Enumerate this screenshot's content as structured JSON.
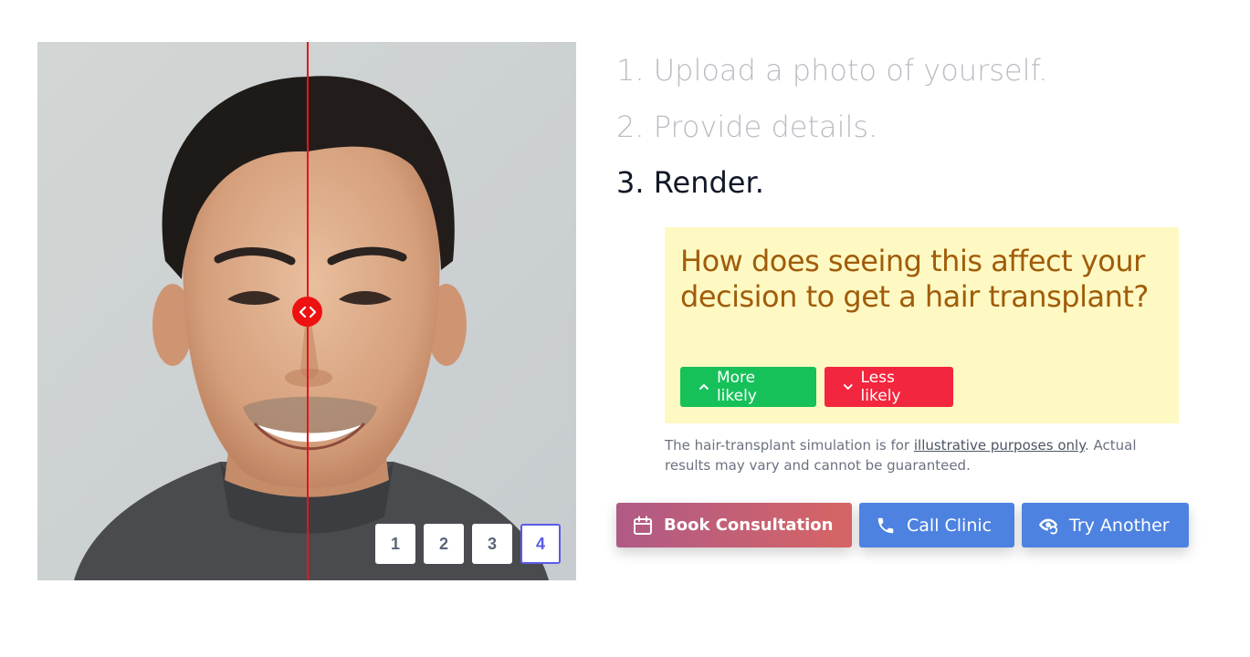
{
  "comparison": {
    "handle_icon": "code-arrows-icon",
    "thumbnails": [
      "1",
      "2",
      "3",
      "4"
    ],
    "active_thumbnail": "4"
  },
  "steps": [
    {
      "label": "1. Upload a photo of yourself."
    },
    {
      "label": "2. Provide details."
    },
    {
      "label": "3. Render."
    }
  ],
  "question": {
    "text": "How does seeing this affect your decision to get a hair transplant?",
    "more_label": "More likely",
    "more_icon": "chevron-up-icon",
    "less_label": "Less likely",
    "less_icon": "chevron-down-icon"
  },
  "disclaimer": {
    "before": "The hair-transplant simulation is for ",
    "link": "illustrative purposes only",
    "after": ". Actual results may vary and cannot be guaranteed."
  },
  "actions": {
    "book_label": "Book Consultation",
    "book_icon": "calendar-icon",
    "call_label": "Call Clinic",
    "call_icon": "phone-icon",
    "try_label": "Try Another",
    "try_icon": "eye-refresh-icon"
  },
  "colors": {
    "divider": "#e8141b",
    "question_bg": "#fef9c3",
    "question_text": "#a15c0a",
    "more": "#16c15a",
    "less": "#f2263e",
    "primary": "#4d82e0",
    "thumb_active": "#5b5be6"
  }
}
